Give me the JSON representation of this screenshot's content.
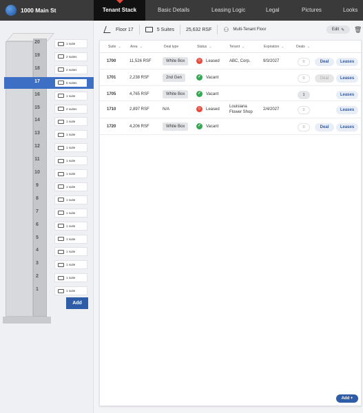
{
  "app": {
    "title": "1000 Main St"
  },
  "tabs": [
    {
      "label": "Tenant Stack"
    },
    {
      "label": "Basic Details"
    },
    {
      "label": "Leasing Logic"
    },
    {
      "label": "Legal"
    },
    {
      "label": "Pictures"
    },
    {
      "label": "Looks"
    }
  ],
  "stack": {
    "floors": [
      {
        "num": "20",
        "suites": "1 suite"
      },
      {
        "num": "19",
        "suites": "2 suites"
      },
      {
        "num": "18",
        "suites": "2 suites"
      },
      {
        "num": "17",
        "suites": "5 suites",
        "selected": true
      },
      {
        "num": "16",
        "suites": "1 suite"
      },
      {
        "num": "15",
        "suites": "2 suites"
      },
      {
        "num": "14",
        "suites": "1 suite"
      },
      {
        "num": "13",
        "suites": "1 suite"
      },
      {
        "num": "12",
        "suites": "1 suite"
      },
      {
        "num": "11",
        "suites": "1 suite"
      },
      {
        "num": "10",
        "suites": "1 suite"
      },
      {
        "num": "9",
        "suites": "1 suite"
      },
      {
        "num": "8",
        "suites": "1 suite"
      },
      {
        "num": "7",
        "suites": "1 suite"
      },
      {
        "num": "6",
        "suites": "1 suite"
      },
      {
        "num": "5",
        "suites": "1 suite"
      },
      {
        "num": "4",
        "suites": "1 suite"
      },
      {
        "num": "3",
        "suites": "1 suite"
      },
      {
        "num": "2",
        "suites": "1 suite"
      },
      {
        "num": "1",
        "suites": "1 suite"
      }
    ],
    "add_label": "Add"
  },
  "floor_header": {
    "floor_label": "Floor 17",
    "suites_label": "5 Suites",
    "area_label": "25,632 RSF",
    "tenancy_label": "Multi-Tenant Floor",
    "edit_label": "Edit"
  },
  "table": {
    "columns": [
      "Suite",
      "Area",
      "Deal type",
      "Status",
      "Tenant",
      "Expiration",
      "Deals"
    ],
    "rows": [
      {
        "suite": "1700",
        "area": "11,526 RSF",
        "deal_type": "White Box",
        "status": "Leased",
        "tenant": "ABC, Corp.",
        "expiration": "9/3/2027",
        "deals": "0",
        "deal_btn": "Deal",
        "leases_btn": "Leases"
      },
      {
        "suite": "1701",
        "area": "2,238 RSF",
        "deal_type": "2nd Gen",
        "status": "Vacant",
        "tenant": "",
        "expiration": "",
        "deals": "0",
        "deal_btn": "Deal",
        "leases_btn": "Leases"
      },
      {
        "suite": "1705",
        "area": "4,765 RSF",
        "deal_type": "White Box",
        "status": "Vacant",
        "tenant": "",
        "expiration": "",
        "deals": "1",
        "deal_btn": "",
        "leases_btn": "Leases"
      },
      {
        "suite": "1710",
        "area": "2,897 RSF",
        "deal_type": "N/A",
        "status": "Leased",
        "tenant": "Louisiana Flower Shop",
        "expiration": "2/4/2027",
        "deals": "0",
        "deal_btn": "",
        "leases_btn": "Leases"
      },
      {
        "suite": "1720",
        "area": "4,206 RSF",
        "deal_type": "White Box",
        "status": "Vacant",
        "tenant": "",
        "expiration": "",
        "deals": "0",
        "deal_btn": "Deal",
        "leases_btn": "Leases"
      }
    ],
    "add_label": "Add +"
  },
  "colors": {
    "accent": "#2f5ca6",
    "selected_floor": "#3d6fc4",
    "leased": "#e8493b",
    "vacant": "#35a852",
    "nav_bg": "#3a3a3a"
  }
}
